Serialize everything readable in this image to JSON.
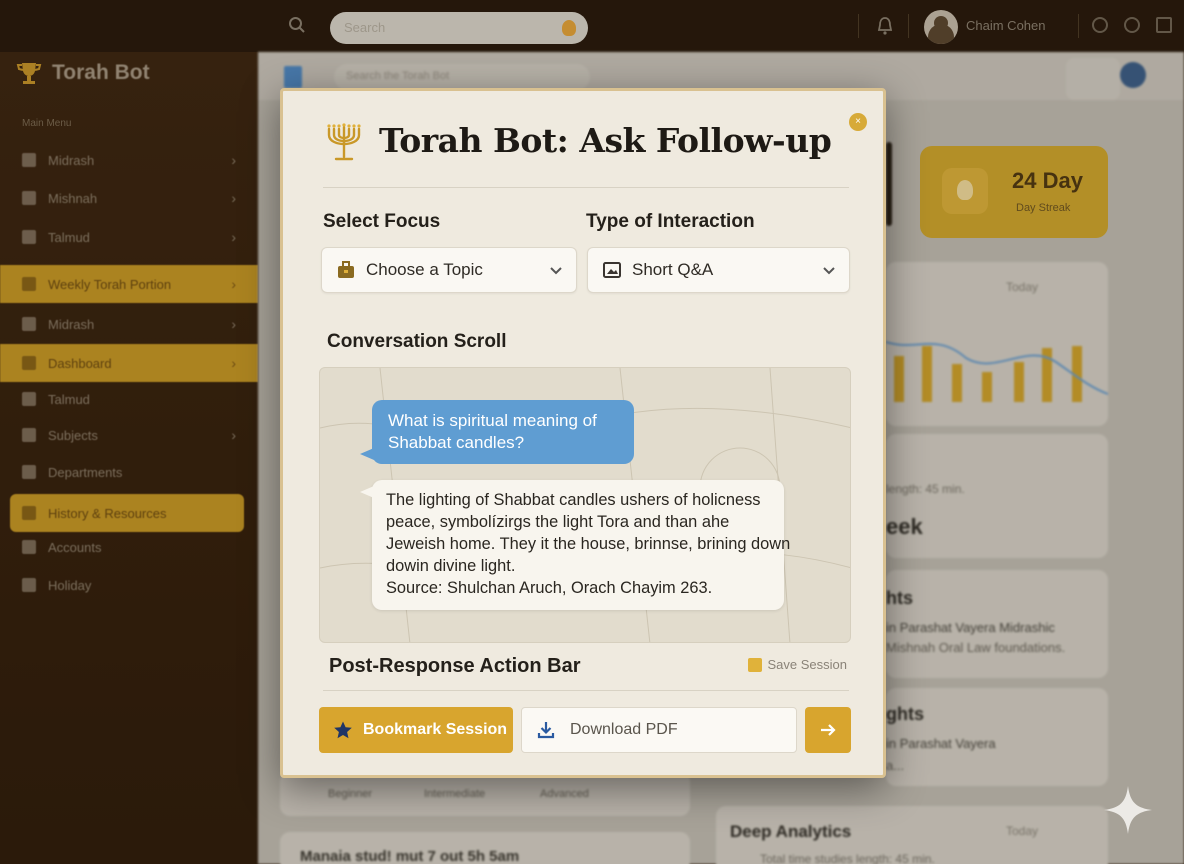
{
  "topbar": {
    "search_placeholder": "Search",
    "user_name": "Chaim Cohen"
  },
  "sidebar": {
    "brand": "Torah Bot",
    "section_label": "Main Menu",
    "items": [
      {
        "label": "Midrash",
        "chevron": "›"
      },
      {
        "label": "Mishnah",
        "chevron": "›"
      },
      {
        "label": "Talmud",
        "chevron": "›"
      },
      {
        "label": "Weekly Torah Portion",
        "chevron": "›"
      },
      {
        "label": "Midrash",
        "chevron": "›"
      },
      {
        "label": "Dashboard",
        "chevron": "›"
      },
      {
        "label": "Talmud",
        "chevron": ""
      },
      {
        "label": "Subjects",
        "chevron": "›"
      },
      {
        "label": "Departments",
        "chevron": ""
      },
      {
        "label": "History & Resources",
        "chevron": ""
      },
      {
        "label": "Accounts",
        "chevron": ""
      },
      {
        "label": "Holiday",
        "chevron": ""
      }
    ]
  },
  "dashboard": {
    "search_placeholder": "Search the Torah Bot",
    "streak_number": "24 Day",
    "streak_label": "Day Streak",
    "filter_today": "Today",
    "length_text": "length: 45 min.",
    "week_heading": "eek",
    "insight1_title": "hts",
    "insight1_line1": "in Parashat Vayera Midrashic",
    "insight1_line2": "Mishnah Oral Law foundations.",
    "insight2_title": "ghts",
    "insight2_line1": "in Parashat Vayera",
    "insight2_line2": "a...",
    "deep_analytics": "Deep Analytics",
    "deep_filter": "Today",
    "deep_sub": "Total time studies length: 45 min.",
    "tabs": [
      "Beginner",
      "Intermediate",
      "Advanced"
    ],
    "bottom_text": "Manaia stud! mut 7 out 5h 5am"
  },
  "modal": {
    "title": "Torah Bot: Ask Follow-up",
    "close_label": "×",
    "focus_label": "Select Focus",
    "focus_value": "Choose a Topic",
    "interaction_label": "Type of Interaction",
    "interaction_value": "Short Q&A",
    "conversation_label": "Conversation Scroll",
    "user_message": "What is spiritual meaning of Shabbat candles?",
    "bot_lines": [
      "The lighting of Shabbat candles ushers of holicness",
      "peace, symbolízirgs the light Tora and than ahe",
      "Jeweish home. They it the house, brinnse, brining down",
      "dowin divine light.",
      "Source: Shulchan Aruch, Orach Chayim 263."
    ],
    "action_bar_label": "Post-Response Action Bar",
    "save_session": "Save Session",
    "bookmark_label": "Bookmark Session",
    "download_label": "Download PDF"
  },
  "colors": {
    "accent_gold": "#d8a52e",
    "user_bubble": "#5f9dd2",
    "sidebar_bg": "#3a2410"
  }
}
